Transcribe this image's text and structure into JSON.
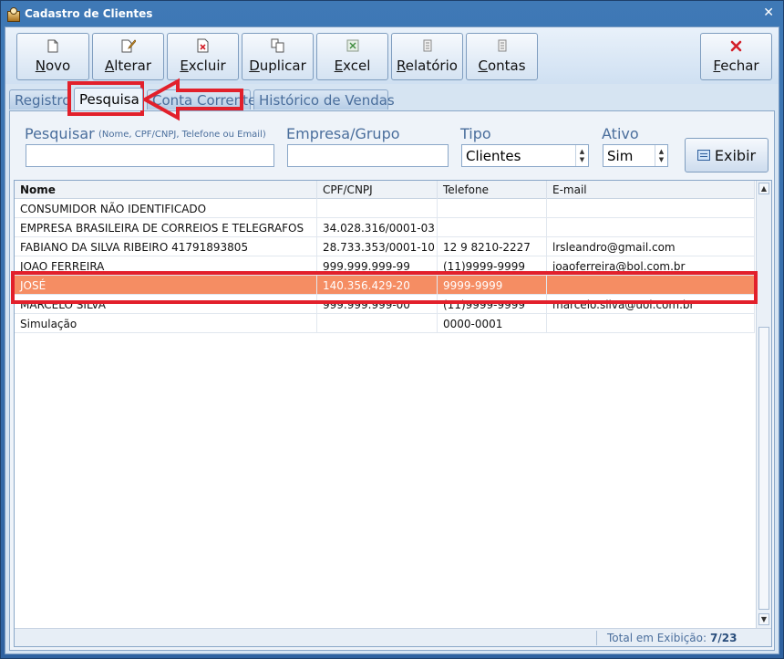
{
  "window": {
    "title": "Cadastro de Clientes",
    "close": "✕"
  },
  "toolbar": {
    "novo": "Novo",
    "alterar": "Alterar",
    "excluir": "Excluir",
    "duplicar": "Duplicar",
    "excel": "Excel",
    "relatorio": "Relatório",
    "contas": "Contas",
    "fechar": "Fechar"
  },
  "tabs": [
    "Registro",
    "Pesquisa",
    "Conta Corrente",
    "Histórico de Vendas"
  ],
  "search": {
    "pesquisar_label": "Pesquisar",
    "pesquisar_hint": "(Nome, CPF/CNPJ, Telefone ou Email)",
    "pesquisar_value": "",
    "empresa_label": "Empresa/Grupo",
    "empresa_value": "",
    "tipo_label": "Tipo",
    "tipo_value": "Clientes",
    "ativo_label": "Ativo",
    "ativo_value": "Sim",
    "exibir": "Exibir"
  },
  "grid": {
    "columns": [
      "Nome",
      "CPF/CNPJ",
      "Telefone",
      "E-mail"
    ],
    "rows": [
      [
        "CONSUMIDOR NÃO IDENTIFICADO",
        "",
        "",
        ""
      ],
      [
        "EMPRESA BRASILEIRA DE CORREIOS E TELEGRAFOS",
        "34.028.316/0001-03",
        "",
        ""
      ],
      [
        "FABIANO DA SILVA RIBEIRO 41791893805",
        "28.733.353/0001-10",
        "12 9 8210-2227",
        "lrsleandro@gmail.com"
      ],
      [
        "JOAO FERREIRA",
        "999.999.999-99",
        "(11)9999-9999",
        "joaoferreira@bol.com.br"
      ],
      [
        "JOSÉ",
        "140.356.429-20",
        "9999-9999",
        ""
      ],
      [
        "MARCELO SILVA",
        "999.999.999-00",
        "(11)9999-9999",
        "marcelo.silva@uol.com.br"
      ],
      [
        "Simulação",
        "",
        "0000-0001",
        ""
      ]
    ],
    "selected_index": 4
  },
  "status": {
    "label": "Total em Exibição:",
    "value": "7/23"
  },
  "colors": {
    "selection": "#f58d63",
    "annotation": "#e2202b"
  }
}
